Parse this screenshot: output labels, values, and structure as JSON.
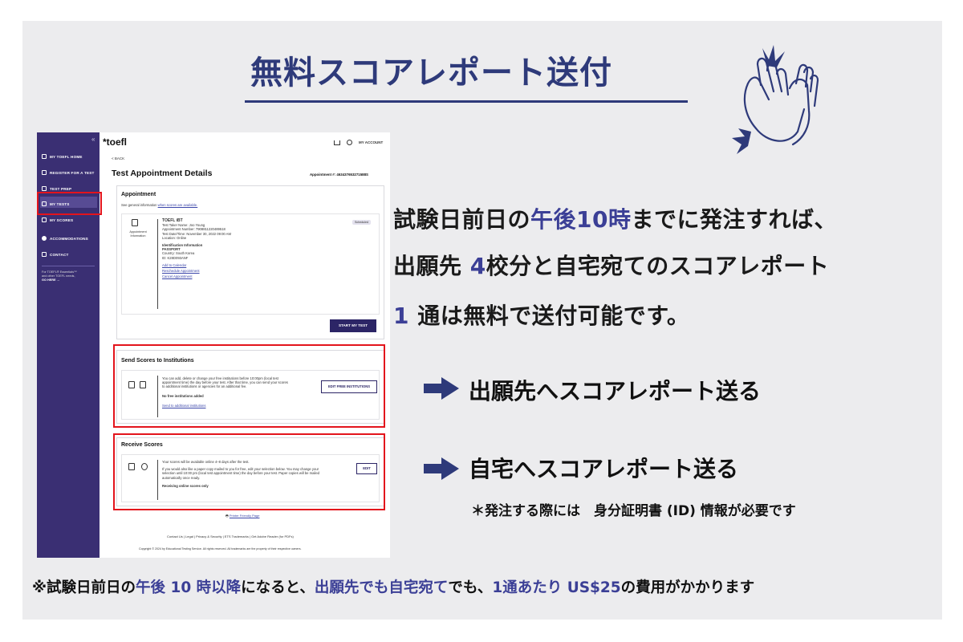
{
  "heading": "無料スコアレポート送付",
  "colors": {
    "accent": "#3b3f96",
    "highlight_box": "#e3141c",
    "sidebar": "#3a2f73"
  },
  "screenshot": {
    "sidebar": {
      "collapse": "«",
      "items": [
        "MY TOEFL HOME",
        "REGISTER FOR A TEST",
        "TEST PREP",
        "MY TESTS",
        "MY SCORES",
        "ACCOMMODATIONS",
        "CONTACT"
      ],
      "promo": [
        "For TOEFL® Essentials™",
        "and other TOEFL needs,",
        "GO HERE →"
      ]
    },
    "header": {
      "logo": "*toefl",
      "account": "MY ACCOUNT"
    },
    "back": "< BACK",
    "page_title": "Test Appointment Details",
    "appointment_number": "Appointment #: 463437653271588S",
    "appointment": {
      "title": "Appointment",
      "general_info_prefix": "See general information ",
      "general_info_link": "when scores are available.",
      "icon_label": [
        "Appointment",
        "Information"
      ],
      "badge": "Scheduled",
      "test_name": "TOEFL iBT",
      "lines": [
        "Test Taker Name: Joo Young",
        "Appointment Number: 7908811220489518",
        "Test Date/Time: November 30, 2022 09:00 AM",
        "Location: Online"
      ],
      "id_header": "Identification Information",
      "id_lines": [
        "PASSPORT",
        "Country: South Korea",
        "ID: K28D093ANF"
      ],
      "links": [
        "Add to Calendar",
        "Reschedule Appointment",
        "Cancel Appointment"
      ],
      "start_button": "START MY TEST"
    },
    "send_scores": {
      "title": "Send Scores to Institutions",
      "body": [
        "You can add, delete or change your free institutions before 10:00pm (local test",
        "appointment time) the day before your test. After that time, you can send your scores",
        "to additional institutions or agencies for an additional fee."
      ],
      "status": "No free institutions added",
      "link": "Send to additional institutions",
      "button": "EDIT FREE INSTITUTIONS"
    },
    "receive_scores": {
      "title": "Receive Scores",
      "line1": "Your scores will be available online 4–8 days after the test.",
      "body": [
        "If you would also like a paper copy mailed to you for free, edit your selection below. You may change your",
        "selection until 10:00 pm (local test appointment time) the day before your test. Paper copies will be mailed",
        "automatically once ready."
      ],
      "status": "Receiving online scores only",
      "button": "EDIT"
    },
    "printer_link": "Printer Friendly Page",
    "footer_links": "Contact Us  |  Legal  |  Privacy & Security  |  ETS Trademarks  |  Get Adobe Reader (for PDFs)",
    "copyright": "Copyright © 2024 by Educational Testing Service. All rights reserved. All trademarks are the property of their respective owners."
  },
  "info": {
    "line1": [
      "試験日前日の",
      "午後10時",
      "までに発注すれば、"
    ],
    "line2": [
      "出願先 ",
      "4",
      "校分と自宅宛てのスコアレポート"
    ],
    "line3": [
      "1",
      " 通は無料で送付可能です。"
    ]
  },
  "arrows": [
    {
      "label": "出願先へスコアレポート送る"
    },
    {
      "label": "自宅へスコアレポート送る"
    }
  ],
  "note": "＊発注する際には　身分証明書 (ID) 情報が必要です",
  "bottom_note": [
    "※試験日前日の",
    "午後 10 時以降",
    "になると、",
    "出願先でも自宅宛て",
    "でも、",
    "1通あたり US$25",
    "の費用がかかります"
  ]
}
